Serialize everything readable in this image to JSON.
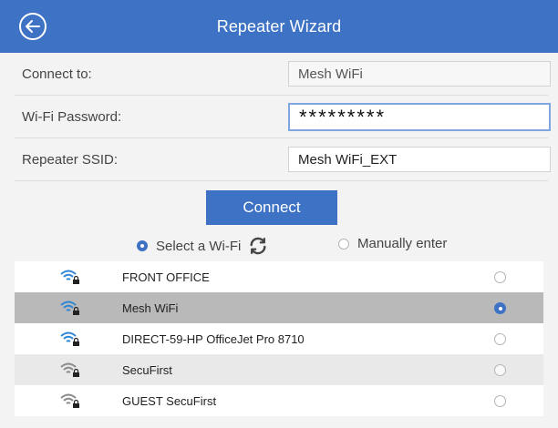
{
  "header": {
    "title": "Repeater Wizard",
    "back_icon": "circle-arrow-left-icon",
    "color": "#3d72c4"
  },
  "form": {
    "connect_to": {
      "label": "Connect to:",
      "value": "Mesh WiFi"
    },
    "password": {
      "label": "Wi-Fi Password:",
      "value": "*********"
    },
    "repeater_ssid": {
      "label": "Repeater SSID:",
      "value": "Mesh WiFi_EXT"
    }
  },
  "connect_label": "Connect",
  "mode": {
    "select_label": "Select a Wi-Fi",
    "manual_label": "Manually enter",
    "selected": "select",
    "refresh_icon": "refresh-icon"
  },
  "networks": [
    {
      "ssid": "FRONT OFFICE",
      "selected": false,
      "locked": true
    },
    {
      "ssid": "Mesh WiFi",
      "selected": true,
      "locked": true
    },
    {
      "ssid": "DIRECT-59-HP OfficeJet Pro 8710",
      "selected": false,
      "locked": true
    },
    {
      "ssid": "SecuFirst",
      "selected": false,
      "locked": true
    },
    {
      "ssid": "GUEST SecuFirst",
      "selected": false,
      "locked": true
    }
  ]
}
